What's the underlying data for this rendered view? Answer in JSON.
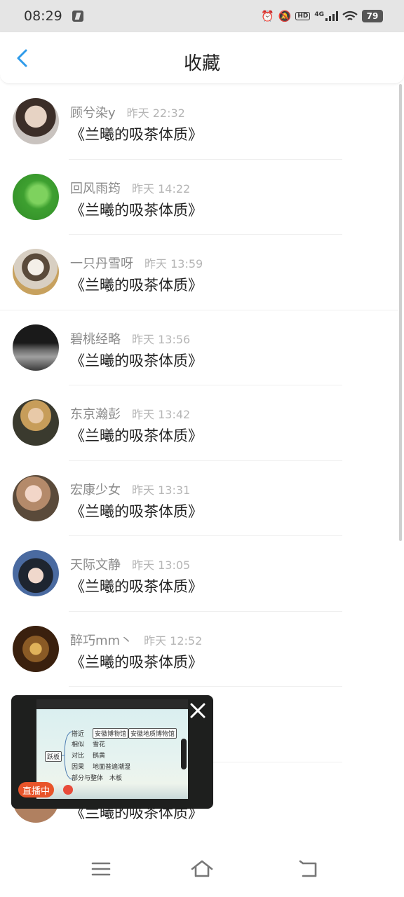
{
  "status_bar": {
    "time": "08:29",
    "icons": [
      "app-icon",
      "alarm-icon",
      "mute-icon",
      "hd-icon",
      "signal-4g-icon",
      "wifi-icon"
    ],
    "hd_label": "HD",
    "network_label": "4G",
    "battery": "79"
  },
  "header": {
    "title": "收藏",
    "back_icon": "chevron-left-icon",
    "accent_color": "#2f9bea"
  },
  "items": [
    {
      "username": "顾兮染y",
      "time": "昨天 22:32",
      "content": "《兰曦的吸茶体质》",
      "avatar_color": "#b9a89a"
    },
    {
      "username": "回风雨筠",
      "time": "昨天 14:22",
      "content": "《兰曦的吸茶体质》",
      "avatar_color": "#4caf3c"
    },
    {
      "username": "一只丹雪呀",
      "time": "昨天 13:59",
      "content": "《兰曦的吸茶体质》",
      "avatar_color": "#d9d3c8"
    },
    {
      "username": "碧桃经略",
      "time": "昨天 13:56",
      "content": "《兰曦的吸茶体质》",
      "avatar_color": "#3a3a3a"
    },
    {
      "username": "东京瀚彭",
      "time": "昨天 13:42",
      "content": "《兰曦的吸茶体质》",
      "avatar_color": "#8a7a5c"
    },
    {
      "username": "宏康少女",
      "time": "昨天 13:31",
      "content": "《兰曦的吸茶体质》",
      "avatar_color": "#a9906f"
    },
    {
      "username": "天际文静",
      "time": "昨天 13:05",
      "content": "《兰曦的吸茶体质》",
      "avatar_color": "#2b3a5a"
    },
    {
      "username": "醉巧mm丶",
      "time": "昨天 12:52",
      "content": "《兰曦的吸茶体质》",
      "avatar_color": "#6a4a25"
    },
    {
      "username": "",
      "time": "",
      "content": "",
      "avatar_color": "#cccccc"
    },
    {
      "username": "",
      "time": "",
      "content": "《兰曦的吸茶体质》",
      "avatar_color": "#c9a990"
    }
  ],
  "live_window": {
    "badge": "直播中",
    "close_icon": "close-icon",
    "mindmap": {
      "root": "跃板",
      "rows": [
        {
          "label": "搭近",
          "items": [
            "安徽博物馆",
            "安徽地质博物馆"
          ]
        },
        {
          "label": "相似",
          "items": [
            "雪花"
          ]
        },
        {
          "label": "对比",
          "items": [
            "鹅黄"
          ]
        },
        {
          "label": "因果",
          "items": [
            "地面普遍潮湿"
          ]
        },
        {
          "label": "部分与整体",
          "items": [
            "木板"
          ]
        }
      ]
    }
  },
  "nav": {
    "menu_icon": "menu-icon",
    "home_icon": "home-icon",
    "back_icon": "return-icon"
  }
}
